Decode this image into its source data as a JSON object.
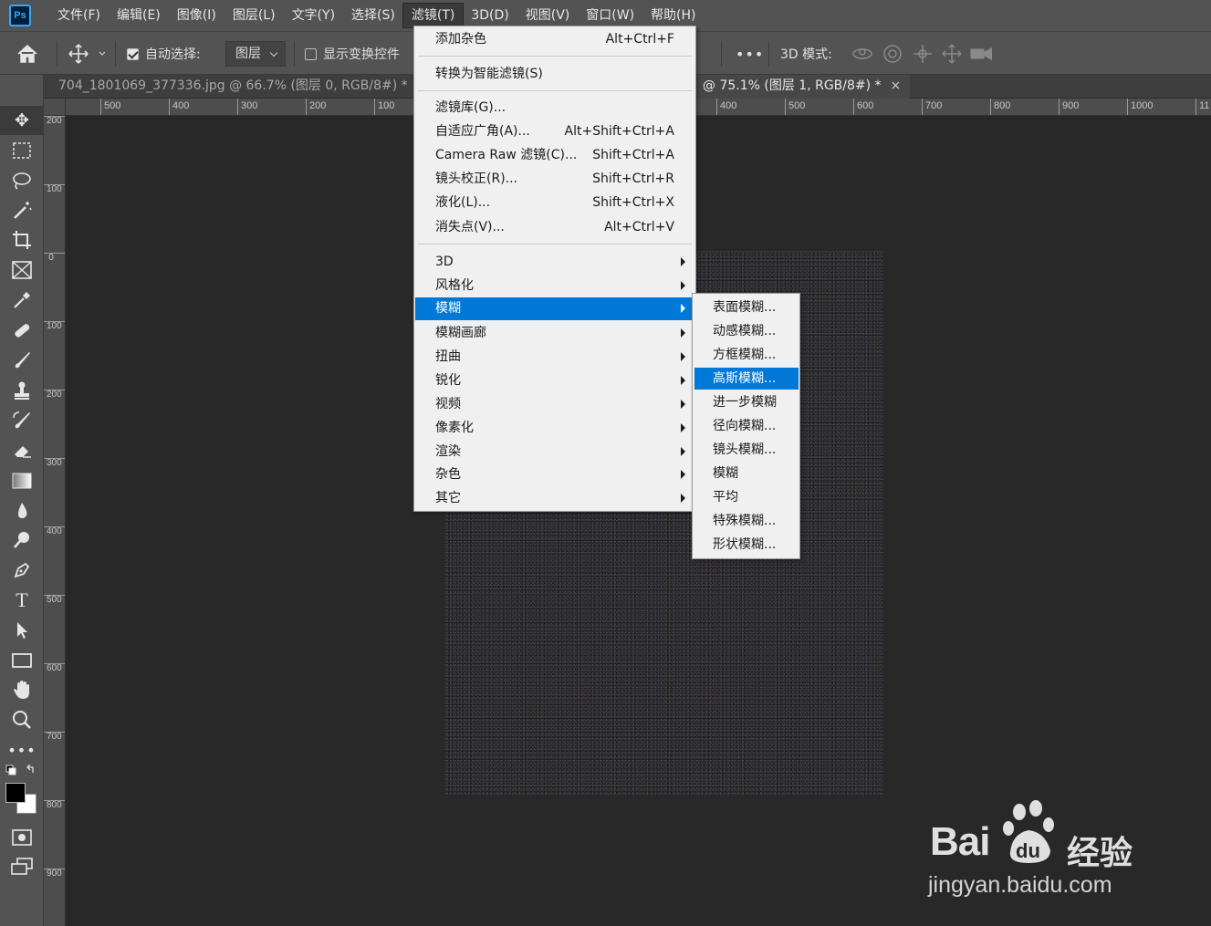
{
  "app": {
    "logo": "Ps",
    "menus": [
      "文件(F)",
      "编辑(E)",
      "图像(I)",
      "图层(L)",
      "文字(Y)",
      "选择(S)",
      "滤镜(T)",
      "3D(D)",
      "视图(V)",
      "窗口(W)",
      "帮助(H)"
    ],
    "active_menu": "滤镜(T)"
  },
  "options_bar": {
    "auto_select_label": "自动选择:",
    "auto_select_checked": true,
    "auto_select_target": "图层",
    "show_transform_label": "显示变换控件",
    "show_transform_checked": false,
    "more": "•••",
    "mode_3d_label": "3D 模式:"
  },
  "tabs": [
    {
      "title": "704_1801069_377336.jpg @ 66.7% (图层 0, RGB/8#) *",
      "close": "×",
      "active": false
    },
    {
      "title": "@ 75.1% (图层 1, RGB/8#) *",
      "close": "×",
      "active": true
    }
  ],
  "ruler": {
    "horizontal": [
      "500",
      "400",
      "300",
      "200",
      "100",
      "400",
      "500",
      "600",
      "700",
      "800",
      "900",
      "1000",
      "11"
    ],
    "vertical": [
      "200",
      "100",
      "0",
      "100",
      "200",
      "300",
      "400",
      "500",
      "600",
      "700",
      "800",
      "900"
    ]
  },
  "filter_menu": {
    "items": [
      {
        "label": "添加杂色",
        "shortcut": "Alt+Ctrl+F"
      },
      {
        "label": "转换为智能滤镜(S)",
        "shortcut": ""
      },
      {
        "label": "滤镜库(G)...",
        "shortcut": ""
      },
      {
        "label": "自适应广角(A)...",
        "shortcut": "Alt+Shift+Ctrl+A"
      },
      {
        "label": "Camera Raw 滤镜(C)...",
        "shortcut": "Shift+Ctrl+A"
      },
      {
        "label": "镜头校正(R)...",
        "shortcut": "Shift+Ctrl+R"
      },
      {
        "label": "液化(L)...",
        "shortcut": "Shift+Ctrl+X"
      },
      {
        "label": "消失点(V)...",
        "shortcut": "Alt+Ctrl+V"
      },
      {
        "label": "3D",
        "submenu": true
      },
      {
        "label": "风格化",
        "submenu": true
      },
      {
        "label": "模糊",
        "submenu": true,
        "highlighted": true
      },
      {
        "label": "模糊画廊",
        "submenu": true
      },
      {
        "label": "扭曲",
        "submenu": true
      },
      {
        "label": "锐化",
        "submenu": true
      },
      {
        "label": "视频",
        "submenu": true
      },
      {
        "label": "像素化",
        "submenu": true
      },
      {
        "label": "渲染",
        "submenu": true
      },
      {
        "label": "杂色",
        "submenu": true
      },
      {
        "label": "其它",
        "submenu": true
      }
    ]
  },
  "blur_submenu": {
    "items": [
      "表面模糊...",
      "动感模糊...",
      "方框模糊...",
      "高斯模糊...",
      "进一步模糊",
      "径向模糊...",
      "镜头模糊...",
      "模糊",
      "平均",
      "特殊模糊...",
      "形状模糊..."
    ],
    "highlighted": "高斯模糊..."
  },
  "watermark": {
    "brand": "Bai",
    "jingyan": "经验",
    "url": "jingyan.baidu.com"
  },
  "colors": {
    "highlight": "#0078d7",
    "panel": "#535353",
    "canvas_bg": "#282828",
    "foreground": "#000000",
    "background": "#ffffff"
  }
}
